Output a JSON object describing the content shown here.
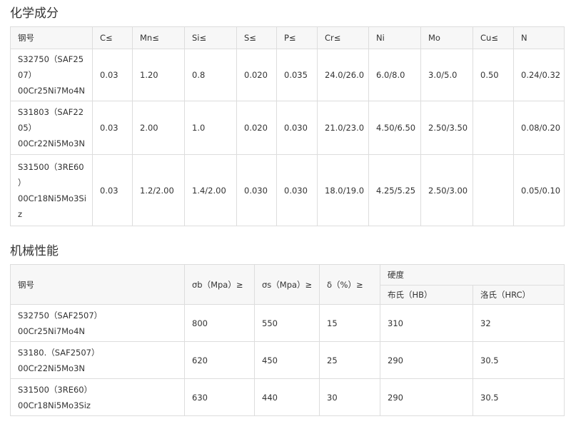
{
  "chem": {
    "title": "化学成分",
    "headers": [
      "钢号",
      "C≤",
      "Mn≤",
      "Si≤",
      "S≤",
      "P≤",
      "Cr≤",
      "Ni",
      "Mo",
      "Cu≤",
      "N"
    ],
    "rows": [
      {
        "grade_lines": [
          "S32750（SAF25",
          "07）",
          "00Cr25Ni7Mo4N"
        ],
        "values": [
          "0.03",
          "1.20",
          "0.8",
          "0.020",
          "0.035",
          "24.0/26.0",
          "6.0/8.0",
          "3.0/5.0",
          "0.50",
          "0.24/0.32"
        ]
      },
      {
        "grade_lines": [
          "S31803（SAF22",
          "05）",
          "00Cr22Ni5Mo3N"
        ],
        "values": [
          "0.03",
          "2.00",
          "1.0",
          "0.020",
          "0.030",
          "21.0/23.0",
          "4.50/6.50",
          "2.50/3.50",
          "",
          "0.08/0.20"
        ]
      },
      {
        "grade_lines": [
          "S31500（3RE60",
          "）",
          "00Cr18Ni5Mo3Si",
          "z"
        ],
        "values": [
          "0.03",
          "1.2/2.00",
          "1.4/2.00",
          "0.030",
          "0.030",
          "18.0/19.0",
          "4.25/5.25",
          "2.50/3.00",
          "",
          "0.05/0.10"
        ]
      }
    ]
  },
  "mech": {
    "title": "机械性能",
    "headers": {
      "grade": "钢号",
      "sigma_b": "σb（Mpa）≥",
      "sigma_s": "σs（Mpa）≥",
      "delta": "δ（%）≥",
      "hardness": "硬度",
      "hb": "布氏（HB）",
      "hrc": "洛氏（HRC）"
    },
    "rows": [
      {
        "grade_lines": [
          "S32750（SAF2507）",
          "00Cr25Ni7Mo4N"
        ],
        "sigma_b": "800",
        "sigma_s": "550",
        "delta": "15",
        "hb": "310",
        "hrc": "32"
      },
      {
        "grade_lines": [
          "S3180.（SAF2507）",
          "00Cr22Ni5Mo3N"
        ],
        "sigma_b": "620",
        "sigma_s": "450",
        "delta": "25",
        "hb": "290",
        "hrc": "30.5"
      },
      {
        "grade_lines": [
          "S31500（3RE60）",
          "00Cr18Ni5Mo3Siz"
        ],
        "sigma_b": "630",
        "sigma_s": "440",
        "delta": "30",
        "hb": "290",
        "hrc": "30.5"
      }
    ]
  }
}
